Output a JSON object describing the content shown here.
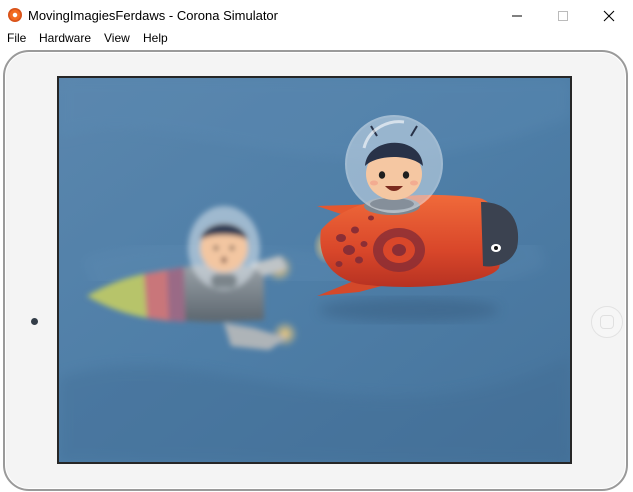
{
  "window": {
    "title": "MovingImagiesFerdaws - Corona Simulator",
    "icon": "corona-app-icon",
    "controls": [
      "minimize-icon",
      "maximize-icon",
      "close-icon"
    ]
  },
  "menu": {
    "items": [
      {
        "label": "File"
      },
      {
        "label": "Hardware"
      },
      {
        "label": "View"
      },
      {
        "label": "Help"
      }
    ]
  },
  "device": {
    "skin": "tablet-landscape",
    "home_button_icon": "home-button-icon"
  },
  "scene": {
    "background_color": "#4f7fa8",
    "sprites": [
      "blurred-rocket-character",
      "red-rocket-character"
    ]
  }
}
